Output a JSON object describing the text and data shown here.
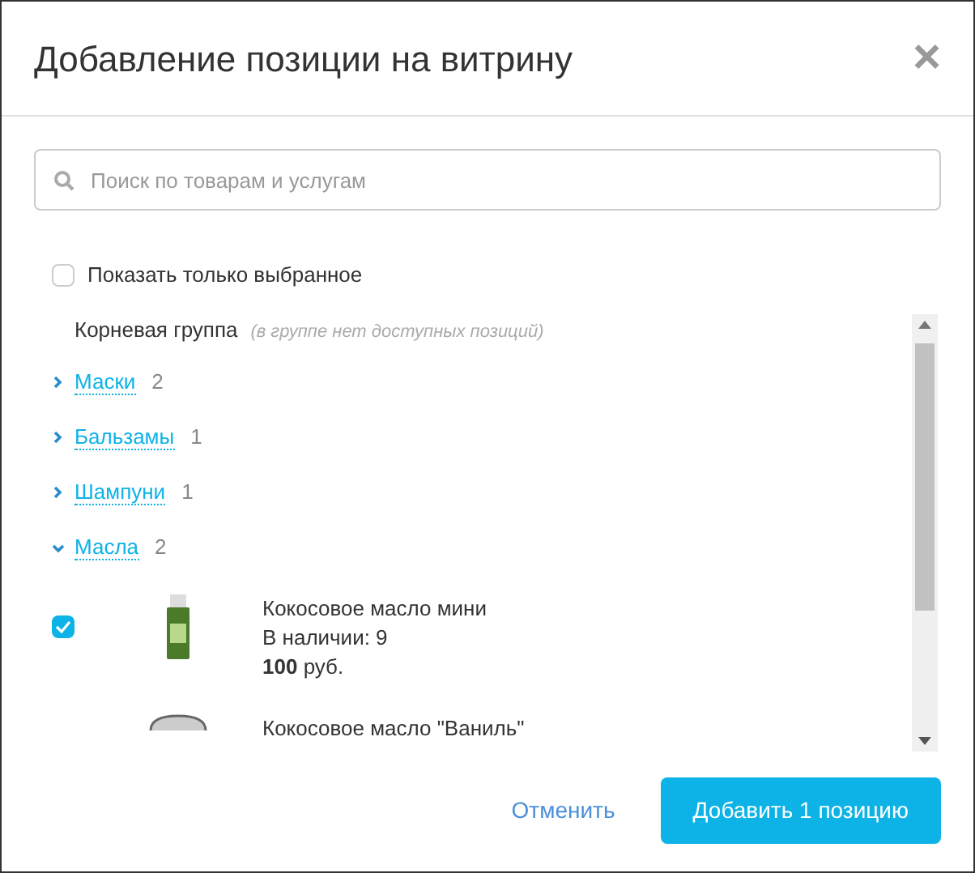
{
  "dialog": {
    "title": "Добавление позиции на витрину",
    "close": "×"
  },
  "search": {
    "placeholder": "Поиск по товарам и услугам"
  },
  "filter": {
    "label": "Показать только выбранное",
    "checked": false
  },
  "root": {
    "name": "Корневая группа",
    "note": "(в группе нет доступных позиций)"
  },
  "groups": [
    {
      "name": "Маски",
      "count": "2",
      "expanded": false
    },
    {
      "name": "Бальзамы",
      "count": "1",
      "expanded": false
    },
    {
      "name": "Шампуни",
      "count": "1",
      "expanded": false
    },
    {
      "name": "Масла",
      "count": "2",
      "expanded": true,
      "items": [
        {
          "name": "Кокосовое масло мини",
          "stock": "В наличии: 9",
          "price": "100",
          "currency": "руб.",
          "checked": true,
          "kind": "bottle"
        },
        {
          "name": "Кокосовое масло \"Ваниль\"",
          "kind": "jar"
        }
      ]
    }
  ],
  "footer": {
    "cancel": "Отменить",
    "submit": "Добавить 1 позицию"
  }
}
